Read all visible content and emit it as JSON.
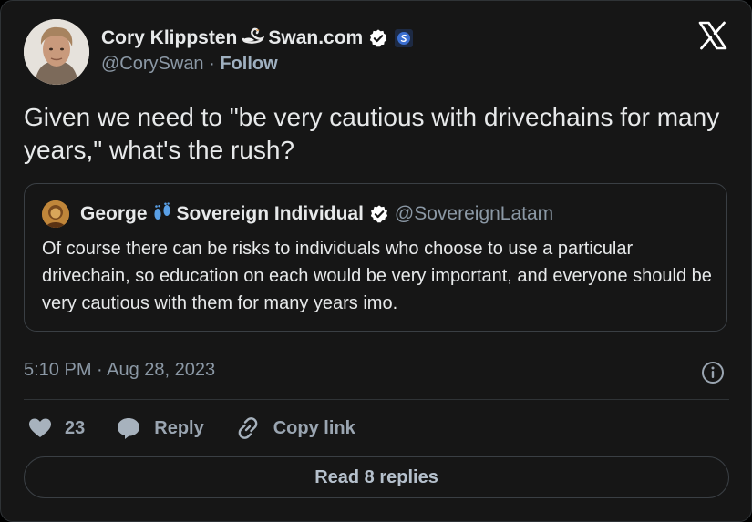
{
  "author": {
    "name": "Cory Klippsten",
    "name_suffix": "Swan.com",
    "handle": "@CorySwan",
    "separator": " · ",
    "follow_label": "Follow"
  },
  "tweet": {
    "text": "Given we need to \"be very cautious with drivechains for many years,\" what's the rush?"
  },
  "quoted": {
    "name": "George",
    "name_suffix": "Sovereign Individual",
    "handle": "@SovereignLatam",
    "text": "Of course there can be risks to individuals who choose to use a particular drivechain, so education on each would be very important, and everyone should be very cautious with them for many years imo."
  },
  "meta": {
    "timestamp": "5:10 PM · Aug 28, 2023"
  },
  "actions": {
    "like_count": "23",
    "reply_label": "Reply",
    "copy_label": "Copy link"
  },
  "read_replies_label": "Read 8 replies",
  "colors": {
    "background": "#161616",
    "text": "#e7e9ea",
    "muted": "#8b98a5",
    "verified": "#ffffff"
  },
  "icons": [
    "swan-emoji-icon",
    "verified-icon",
    "org-badge-icon",
    "x-logo-icon",
    "footprints-emoji-icon",
    "info-icon",
    "heart-icon",
    "reply-icon",
    "link-icon"
  ]
}
